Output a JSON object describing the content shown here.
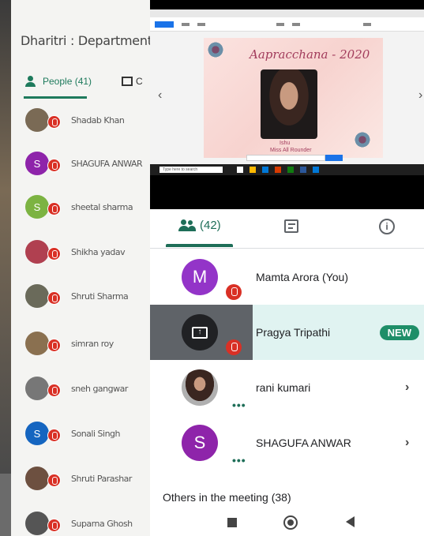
{
  "left_panel": {
    "meeting_title": "Dharitri : Department of ge",
    "people_tab": "People (41)",
    "chat_tab": "C",
    "participants": [
      {
        "name": "Shadab Khan",
        "avatar_letter": "",
        "avatar_color": "#7a6a55"
      },
      {
        "name": "SHAGUFA ANWAR",
        "avatar_letter": "S",
        "avatar_color": "#8e24aa"
      },
      {
        "name": "sheetal sharma",
        "avatar_letter": "S",
        "avatar_color": "#7cb342"
      },
      {
        "name": "Shikha yadav",
        "avatar_letter": "",
        "avatar_color": "#b04050"
      },
      {
        "name": "Shruti Sharma",
        "avatar_letter": "",
        "avatar_color": "#6a6a5a"
      },
      {
        "name": "simran roy",
        "avatar_letter": "",
        "avatar_color": "#8a7050"
      },
      {
        "name": "sneh gangwar",
        "avatar_letter": "",
        "avatar_color": "#777777"
      },
      {
        "name": "Sonali Singh",
        "avatar_letter": "S",
        "avatar_color": "#1565c0"
      },
      {
        "name": "Shruti Parashar",
        "avatar_letter": "",
        "avatar_color": "#6d5040"
      },
      {
        "name": "Suparna Ghosh",
        "avatar_letter": "",
        "avatar_color": "#555555"
      }
    ]
  },
  "shared_screen": {
    "poster_title": "Aapracchana - 2020",
    "poster_name": "Ishu",
    "poster_subtitle": "Miss All Rounder",
    "taskbar_search": "Type here to search"
  },
  "tabs": {
    "people_count": "(42)"
  },
  "participants": [
    {
      "name": "Mamta Arora (You)",
      "avatar_letter": "M",
      "avatar_color": "#9334c8",
      "muted": true
    },
    {
      "name": "Pragya Tripathi",
      "badge": "NEW",
      "presenting": true,
      "muted": true
    },
    {
      "name": "rani kumari",
      "avatar_letter": "",
      "avatar_color": "#5a3020"
    },
    {
      "name": "SHAGUFA ANWAR",
      "avatar_letter": "S",
      "avatar_color": "#8e24aa"
    }
  ],
  "others_label": "Others in the meeting (38)",
  "colors": {
    "accent_green": "#1e6e58",
    "mute_red": "#d93025",
    "highlight": "#e0f3f1"
  }
}
